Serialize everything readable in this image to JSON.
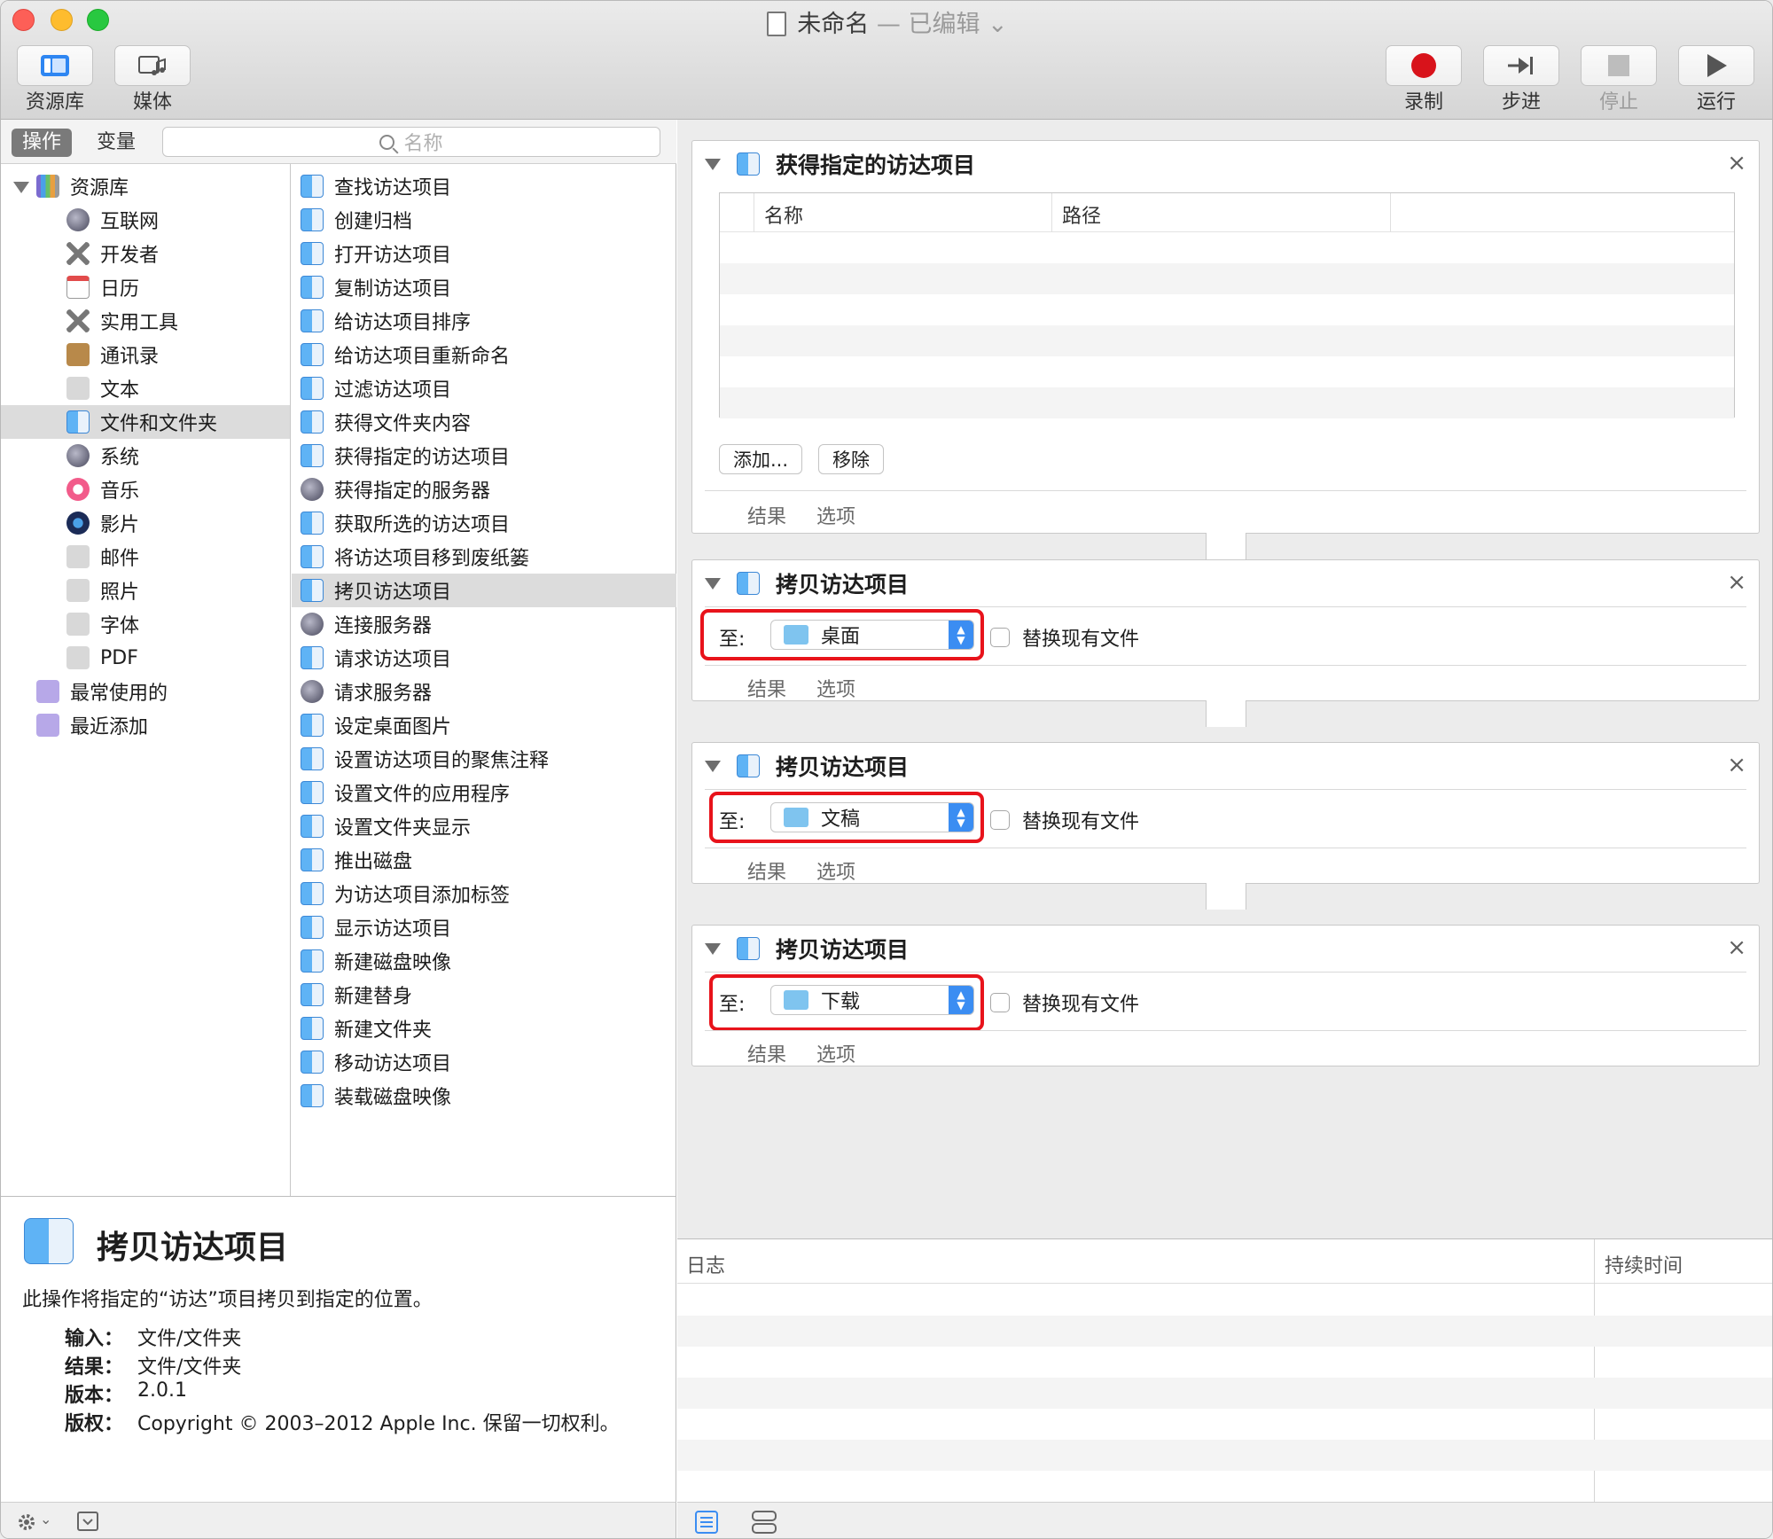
{
  "window": {
    "title": "未命名",
    "title_status": "— 已编辑 ⌄"
  },
  "toolbar": {
    "left": [
      {
        "label": "资源库",
        "icon": "library-icon"
      },
      {
        "label": "媒体",
        "icon": "media-icon"
      }
    ],
    "right": [
      {
        "label": "录制",
        "icon": "record-icon",
        "enabled": true
      },
      {
        "label": "步进",
        "icon": "step-icon",
        "enabled": true
      },
      {
        "label": "停止",
        "icon": "stop-icon",
        "enabled": false
      },
      {
        "label": "运行",
        "icon": "run-icon",
        "enabled": true
      }
    ]
  },
  "library": {
    "tab_actions": "操作",
    "tab_variables": "变量",
    "search_placeholder": "名称",
    "categories": [
      {
        "label": "资源库",
        "icon": "library-books-icon",
        "level": 0,
        "disclosure": true
      },
      {
        "label": "互联网",
        "icon": "globe-icon",
        "level": 1
      },
      {
        "label": "开发者",
        "icon": "tools-icon",
        "level": 1
      },
      {
        "label": "日历",
        "icon": "calendar-icon",
        "level": 1
      },
      {
        "label": "实用工具",
        "icon": "tools-icon",
        "level": 1
      },
      {
        "label": "通讯录",
        "icon": "contacts-icon",
        "level": 1
      },
      {
        "label": "文本",
        "icon": "text-icon",
        "level": 1
      },
      {
        "label": "文件和文件夹",
        "icon": "finder-icon",
        "level": 1,
        "selected": true
      },
      {
        "label": "系统",
        "icon": "system-icon",
        "level": 1
      },
      {
        "label": "音乐",
        "icon": "music-icon",
        "level": 1
      },
      {
        "label": "影片",
        "icon": "movie-icon",
        "level": 1
      },
      {
        "label": "邮件",
        "icon": "mail-icon",
        "level": 1
      },
      {
        "label": "照片",
        "icon": "photos-icon",
        "level": 1
      },
      {
        "label": "字体",
        "icon": "font-icon",
        "level": 1
      },
      {
        "label": "PDF",
        "icon": "pdf-icon",
        "level": 1
      },
      {
        "label": "最常使用的",
        "icon": "smart-folder-icon",
        "level": 0
      },
      {
        "label": "最近添加",
        "icon": "smart-folder-icon",
        "level": 0
      }
    ],
    "actions": [
      {
        "label": "查找访达项目",
        "icon": "finder-icon"
      },
      {
        "label": "创建归档",
        "icon": "finder-icon"
      },
      {
        "label": "打开访达项目",
        "icon": "finder-icon"
      },
      {
        "label": "复制访达项目",
        "icon": "finder-icon"
      },
      {
        "label": "给访达项目排序",
        "icon": "finder-icon"
      },
      {
        "label": "给访达项目重新命名",
        "icon": "finder-icon"
      },
      {
        "label": "过滤访达项目",
        "icon": "finder-icon"
      },
      {
        "label": "获得文件夹内容",
        "icon": "finder-icon"
      },
      {
        "label": "获得指定的访达项目",
        "icon": "finder-icon"
      },
      {
        "label": "获得指定的服务器",
        "icon": "globe-icon"
      },
      {
        "label": "获取所选的访达项目",
        "icon": "finder-icon"
      },
      {
        "label": "将访达项目移到废纸篓",
        "icon": "finder-icon"
      },
      {
        "label": "拷贝访达项目",
        "icon": "finder-icon",
        "selected": true
      },
      {
        "label": "连接服务器",
        "icon": "globe-icon"
      },
      {
        "label": "请求访达项目",
        "icon": "finder-icon"
      },
      {
        "label": "请求服务器",
        "icon": "globe-icon"
      },
      {
        "label": "设定桌面图片",
        "icon": "finder-icon"
      },
      {
        "label": "设置访达项目的聚焦注释",
        "icon": "finder-icon"
      },
      {
        "label": "设置文件的应用程序",
        "icon": "finder-icon"
      },
      {
        "label": "设置文件夹显示",
        "icon": "finder-icon"
      },
      {
        "label": "推出磁盘",
        "icon": "finder-icon"
      },
      {
        "label": "为访达项目添加标签",
        "icon": "finder-icon"
      },
      {
        "label": "显示访达项目",
        "icon": "finder-icon"
      },
      {
        "label": "新建磁盘映像",
        "icon": "finder-icon"
      },
      {
        "label": "新建替身",
        "icon": "finder-icon"
      },
      {
        "label": "新建文件夹",
        "icon": "finder-icon"
      },
      {
        "label": "移动访达项目",
        "icon": "finder-icon"
      },
      {
        "label": "装载磁盘映像",
        "icon": "finder-icon"
      }
    ]
  },
  "description": {
    "title": "拷贝访达项目",
    "text": "此操作将指定的“访达”项目拷贝到指定的位置。",
    "fields": [
      {
        "key": "输入：",
        "value": "文件/文件夹"
      },
      {
        "key": "结果：",
        "value": "文件/文件夹"
      },
      {
        "key": "版本：",
        "value": "2.0.1"
      },
      {
        "key": "版权：",
        "value": "Copyright © 2003–2012 Apple Inc. 保留一切权利。"
      }
    ]
  },
  "workflow": {
    "first_action": {
      "title": "获得指定的访达项目",
      "col_name": "名称",
      "col_path": "路径",
      "add_button": "添加...",
      "remove_button": "移除",
      "results": "结果",
      "options": "选项"
    },
    "copy_actions": [
      {
        "title": "拷贝访达项目",
        "to_label": "至:",
        "destination": "桌面",
        "replace_label": "替换现有文件",
        "results": "结果",
        "options": "选项"
      },
      {
        "title": "拷贝访达项目",
        "to_label": "至:",
        "destination": "文稿",
        "replace_label": "替换现有文件",
        "results": "结果",
        "options": "选项"
      },
      {
        "title": "拷贝访达项目",
        "to_label": "至:",
        "destination": "下载",
        "replace_label": "替换现有文件",
        "results": "结果",
        "options": "选项"
      }
    ],
    "highlight_color": "#e8131b"
  },
  "log": {
    "col_log": "日志",
    "col_duration": "持续时间"
  },
  "colors": {
    "accent": "#3b8df2",
    "record": "#d8131b"
  }
}
